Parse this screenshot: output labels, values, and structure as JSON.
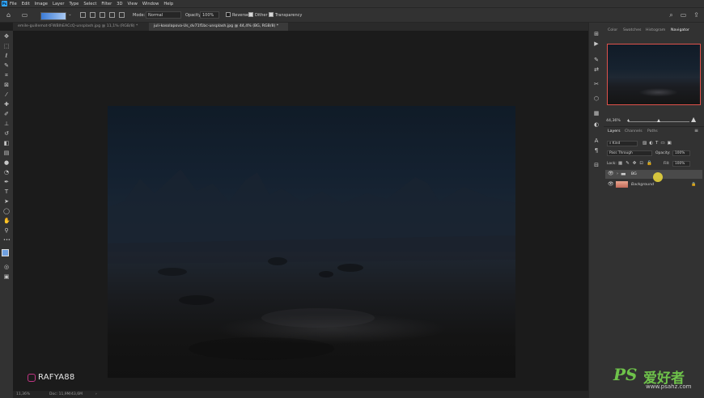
{
  "menubar": {
    "app_icon_label": "Ps",
    "items": [
      "File",
      "Edit",
      "Image",
      "Layer",
      "Type",
      "Select",
      "Filter",
      "3D",
      "View",
      "Window",
      "Help"
    ]
  },
  "options": {
    "mode_label": "Mode:",
    "mode_value": "Normal",
    "opacity_label": "Opacity:",
    "opacity_value": "100%",
    "reverse_label": "Reverse",
    "dither_label": "Dither",
    "transparency_label": "Transparency",
    "gradient_colors": [
      "#3b7bd6",
      "#a9c9f2"
    ]
  },
  "tabs": [
    {
      "label": "emile-guillemot-tFWBlhEACcQ-unsplash.jpg @ 11,1% (RGB/8) *",
      "active": false
    },
    {
      "label": "juli-kosolapova-Us_dv71f1bc-unsplash.jpg @ 44,4% (BG, RGB/8) *",
      "active": true
    }
  ],
  "status": {
    "zoom": "11,36%",
    "doc": "Doc: 11,9M/43,6M"
  },
  "panels": {
    "top_tabs": [
      "Color",
      "Swatches",
      "Histogram",
      "Navigator"
    ],
    "navigator_zoom": "44,36%",
    "layer_tabs": [
      "Layers",
      "Channels",
      "Paths"
    ],
    "kind_value": "Kind",
    "blend_value": "Pass Through",
    "opacity_label": "Opacity:",
    "opacity_value": "100%",
    "lock_label": "Lock:",
    "fill_label": "Fill:",
    "fill_value": "100%",
    "layers": [
      {
        "name": "BG",
        "type": "group",
        "selected": true
      },
      {
        "name": "Background",
        "type": "image",
        "selected": false,
        "locked": true
      }
    ]
  },
  "overlays": {
    "channel_handle": "RAFYA88",
    "watermark_ps": "PS",
    "watermark_cn": "爱好者",
    "watermark_url": "www.psahz.com"
  },
  "colors": {
    "accent_blue": "#31a8ff",
    "navigator_frame": "#e0524b",
    "watermark_green": "#6ec24a",
    "cursor_highlight": "#f0dc3c"
  }
}
